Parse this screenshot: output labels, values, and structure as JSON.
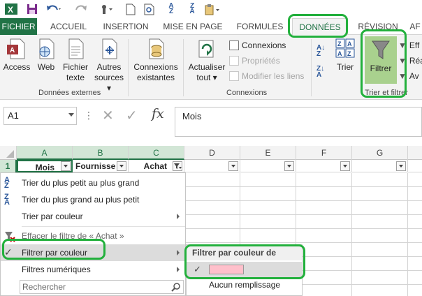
{
  "qat": {
    "icons": [
      "excel-logo-icon",
      "save-icon",
      "undo-icon",
      "redo-icon",
      "touch-mode-icon",
      "new-file-icon",
      "print-preview-icon",
      "sort-az-icon",
      "sort-za-icon",
      "paste-icon"
    ]
  },
  "tabs": {
    "file": "FICHIER",
    "home": "ACCUEIL",
    "insert": "INSERTION",
    "layout": "MISE EN PAGE",
    "formulas": "FORMULES",
    "data": "DONNÉES",
    "review": "RÉVISION",
    "more": "AF"
  },
  "ribbon": {
    "access": "Access",
    "web": "Web",
    "text_l1": "Fichier",
    "text_l2": "texte",
    "other_l1": "Autres",
    "other_l2": "sources ▾",
    "existing_l1": "Connexions",
    "existing_l2": "existantes",
    "group_external": "Données externes",
    "refresh_l1": "Actualiser",
    "refresh_l2": "tout ▾",
    "connections": "Connexions",
    "properties": "Propriétés",
    "edit_links": "Modifier les liens",
    "group_connections": "Connexions",
    "sort": "Trier",
    "filter": "Filtrer",
    "clear_trunc": "Eff",
    "reapply_trunc": "Réa",
    "advanced_trunc": "Av",
    "group_sort_filter": "Trier et filtrer"
  },
  "formula_bar": {
    "name_box": "A1",
    "fx_label": "fx",
    "value": "Mois"
  },
  "grid": {
    "columns": [
      "A",
      "B",
      "C",
      "D",
      "E",
      "F",
      "G"
    ],
    "row_number": "1",
    "headers": {
      "a": "Mois",
      "b": "Fournisse",
      "c": "Achat"
    }
  },
  "menu": {
    "sort_asc": "Trier du plus petit au plus grand",
    "sort_desc": "Trier du plus grand au plus petit",
    "sort_color": "Trier par couleur",
    "clear_filter": "Effacer le filtre de « Achat »",
    "filter_color": "Filtrer par couleur",
    "number_filters": "Filtres numériques",
    "search_placeholder": "Rechercher"
  },
  "submenu": {
    "title": "Filtrer par couleur de cellule",
    "swatch_color": "#ffc0cb",
    "no_fill": "Aucun remplissage"
  },
  "colors": {
    "excel_green": "#217346",
    "annotation_green": "#22b03c",
    "filter_active_bg": "#a9d18e"
  }
}
